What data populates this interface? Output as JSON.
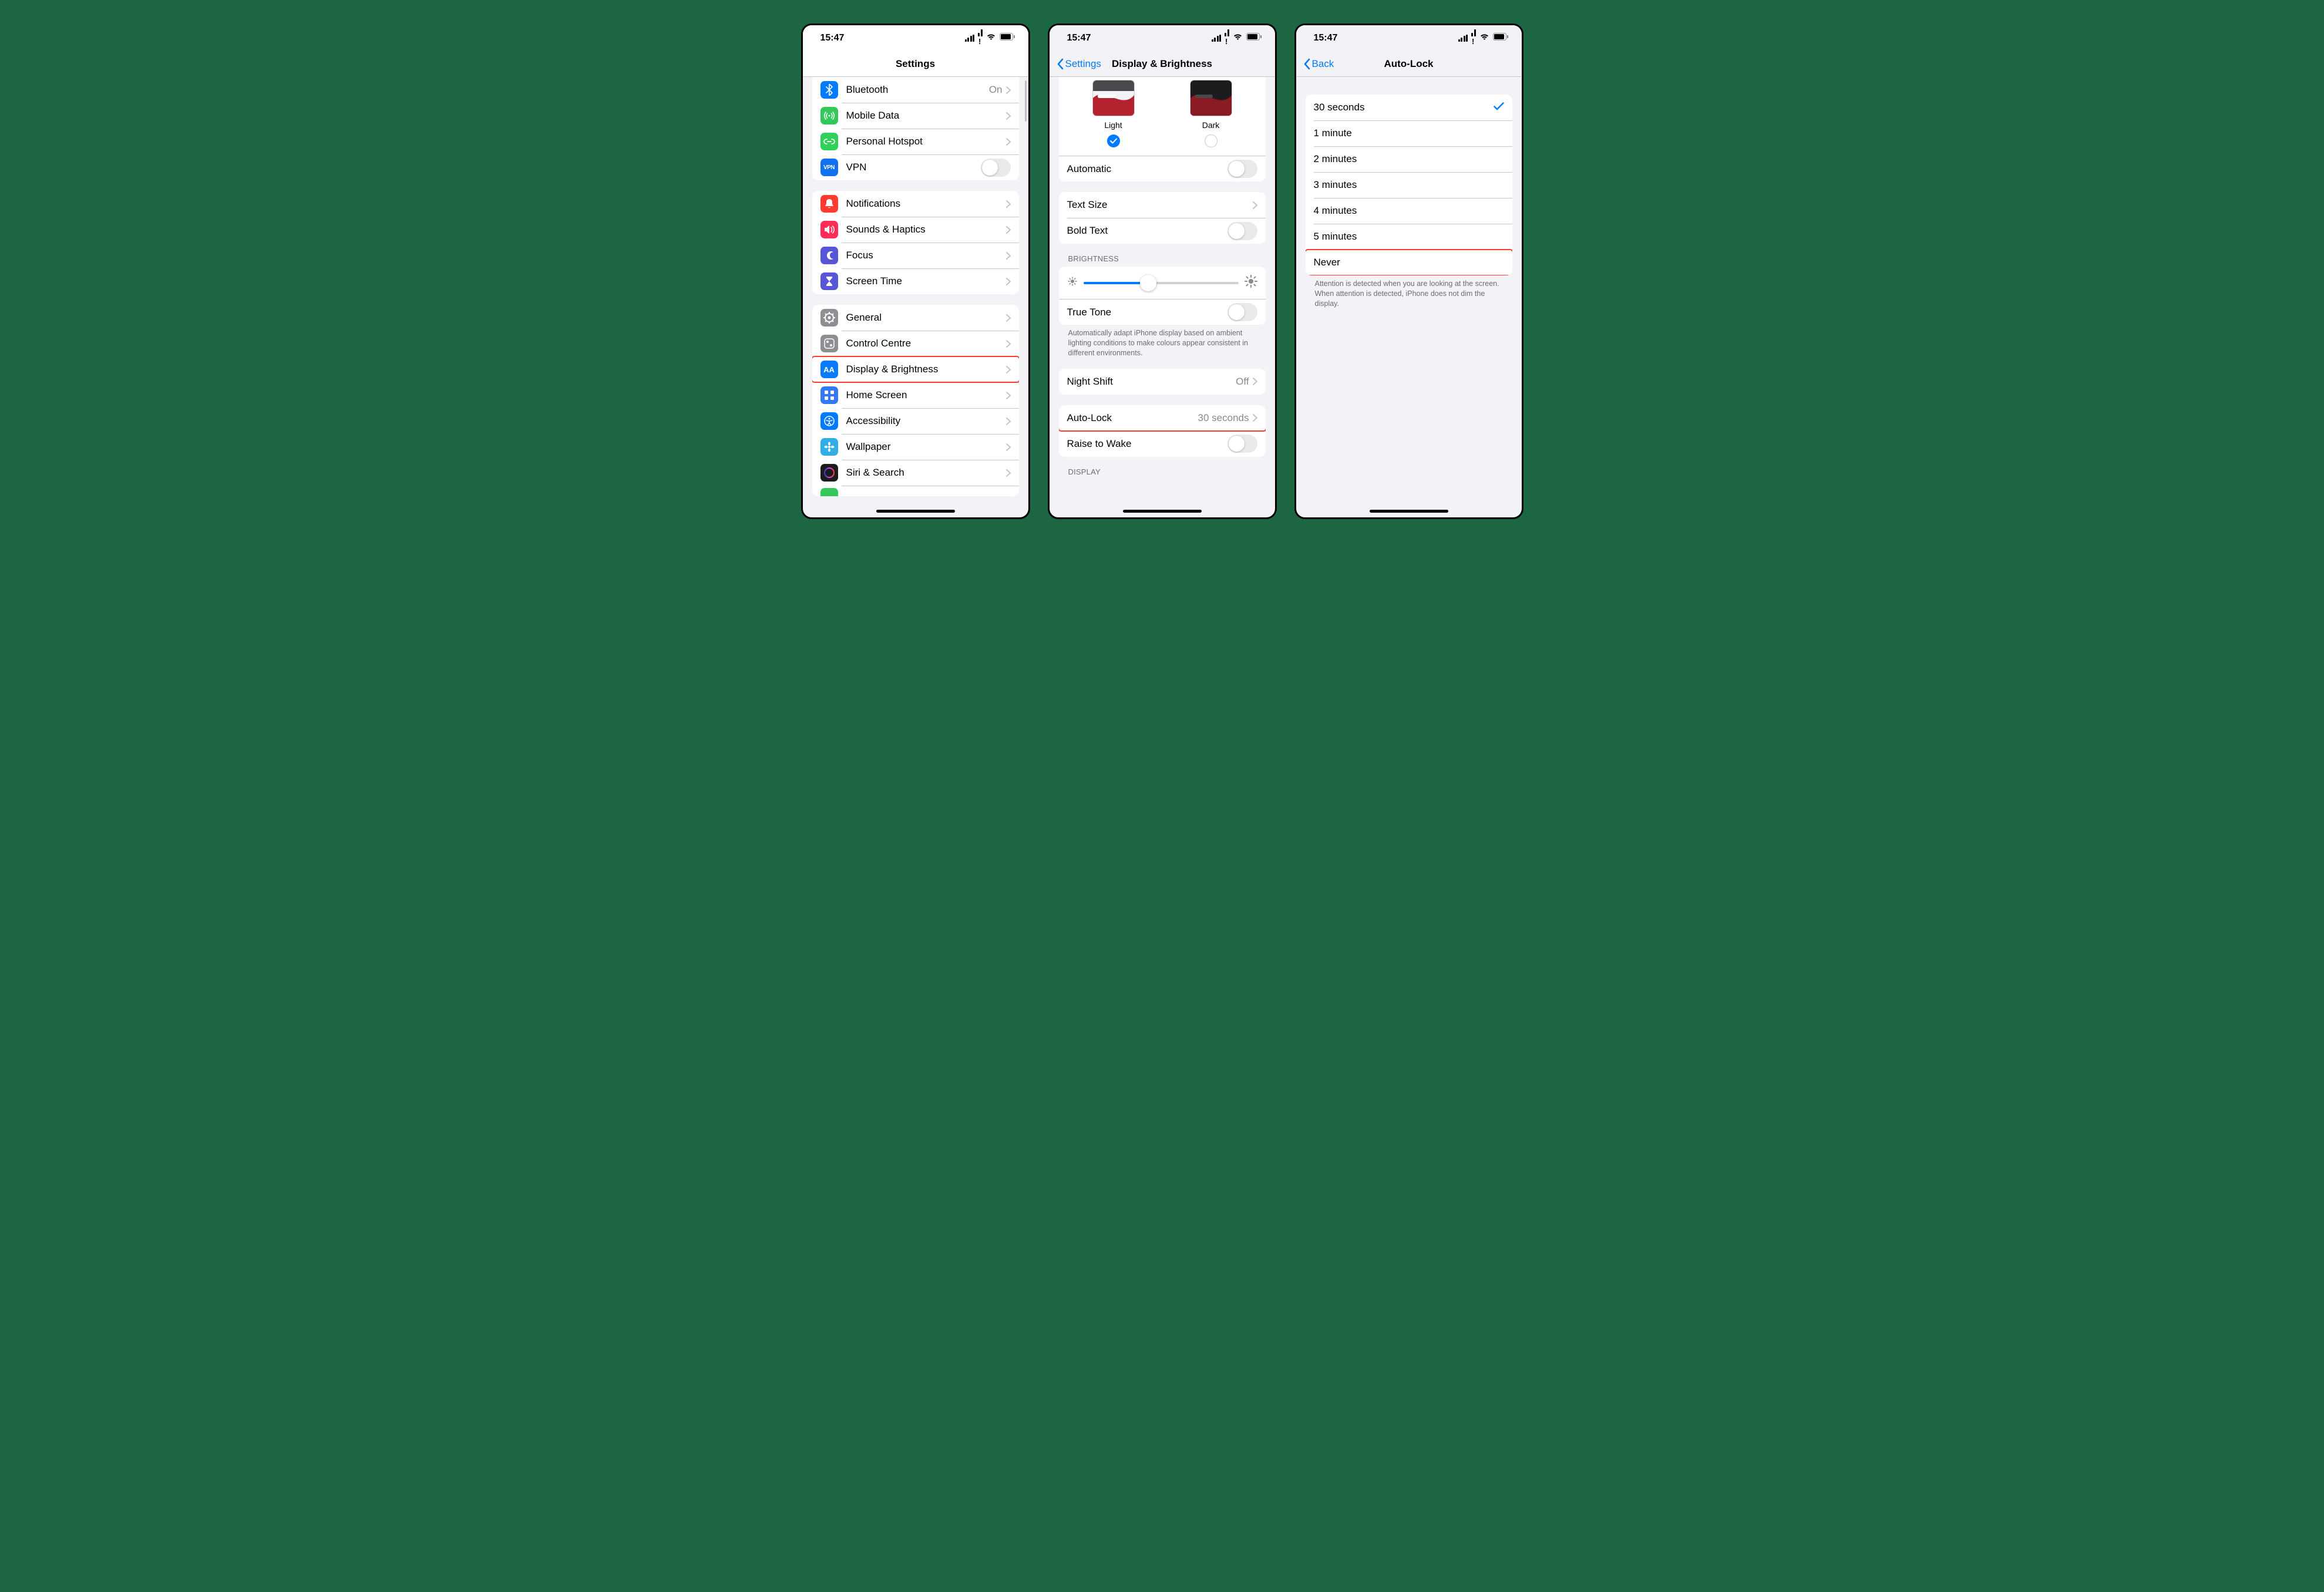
{
  "status": {
    "time": "15:47"
  },
  "screen1": {
    "title": "Settings",
    "rows": {
      "bluetooth": {
        "label": "Bluetooth",
        "detail": "On"
      },
      "mobile_data": {
        "label": "Mobile Data"
      },
      "personal_hotspot": {
        "label": "Personal Hotspot"
      },
      "vpn": {
        "label": "VPN"
      },
      "notifications": {
        "label": "Notifications"
      },
      "sounds": {
        "label": "Sounds & Haptics"
      },
      "focus": {
        "label": "Focus"
      },
      "screen_time": {
        "label": "Screen Time"
      },
      "general": {
        "label": "General"
      },
      "control_centre": {
        "label": "Control Centre"
      },
      "display": {
        "label": "Display & Brightness"
      },
      "home_screen": {
        "label": "Home Screen"
      },
      "accessibility": {
        "label": "Accessibility"
      },
      "wallpaper": {
        "label": "Wallpaper"
      },
      "siri": {
        "label": "Siri & Search"
      }
    }
  },
  "screen2": {
    "back": "Settings",
    "title": "Display & Brightness",
    "appearance": {
      "light": "Light",
      "dark": "Dark"
    },
    "automatic": "Automatic",
    "text_size": "Text Size",
    "bold_text": "Bold Text",
    "brightness_header": "Brightness",
    "true_tone": "True Tone",
    "true_tone_footer": "Automatically adapt iPhone display based on ambient lighting conditions to make colours appear consistent in different environments.",
    "night_shift": {
      "label": "Night Shift",
      "detail": "Off"
    },
    "auto_lock": {
      "label": "Auto-Lock",
      "detail": "30 seconds"
    },
    "raise_to_wake": "Raise to Wake",
    "display_header": "Display",
    "brightness_value_pct": 42
  },
  "screen3": {
    "back": "Back",
    "title": "Auto-Lock",
    "options": [
      {
        "label": "30 seconds",
        "selected": true
      },
      {
        "label": "1 minute",
        "selected": false
      },
      {
        "label": "2 minutes",
        "selected": false
      },
      {
        "label": "3 minutes",
        "selected": false
      },
      {
        "label": "4 minutes",
        "selected": false
      },
      {
        "label": "5 minutes",
        "selected": false
      },
      {
        "label": "Never",
        "selected": false
      }
    ],
    "footer": "Attention is detected when you are looking at the screen. When attention is detected, iPhone does not dim the display."
  }
}
